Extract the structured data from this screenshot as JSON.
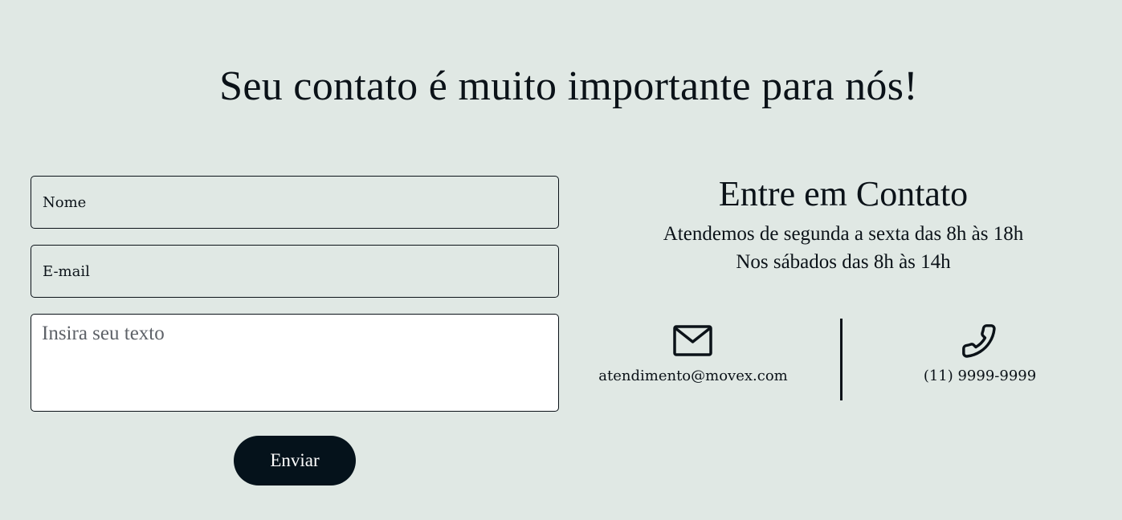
{
  "page": {
    "title": "Seu contato é muito importante para nós!"
  },
  "form": {
    "name_placeholder": "Nome",
    "email_placeholder": "E-mail",
    "message_placeholder": "Insira seu texto",
    "submit_label": "Enviar"
  },
  "contact": {
    "heading": "Entre em Contato",
    "hours_weekday": "Atendemos de segunda a sexta das 8h às 18h",
    "hours_saturday": "Nos sábados das 8h às 14h",
    "email": "atendimento@movex.com",
    "email_icon": "mail-icon",
    "phone": "(11) 9999-9999",
    "phone_icon": "phone-icon"
  },
  "colors": {
    "background": "#e0e8e4",
    "text": "#0b1218",
    "button": "#05121b",
    "button_text": "#ffffff"
  }
}
